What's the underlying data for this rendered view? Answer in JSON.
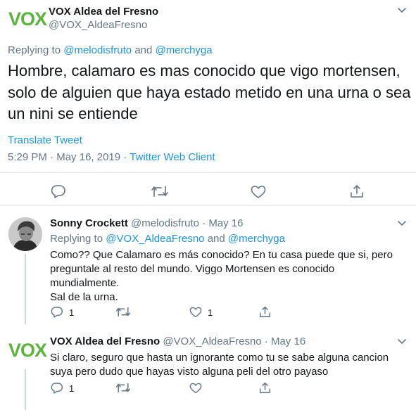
{
  "main_tweet": {
    "logo_text": "VOX",
    "display_name": "VOX Aldea del Fresno",
    "handle": "@VOX_AldeaFresno",
    "replying_prefix": "Replying to",
    "reply_mention_1": "@melodisfruto",
    "reply_and": "and",
    "reply_mention_2": "@merchyga",
    "text": "Hombre, calamaro es mas conocido que vigo mortensen, solo de alguien que haya estado metido en una urna o sea un nini se entiende",
    "translate": "Translate Tweet",
    "time": "5:29 PM",
    "date": "May 16, 2019",
    "dot": "·",
    "client": "Twitter Web Client"
  },
  "reply_1": {
    "display_name": "Sonny Crockett",
    "handle": "@melodisfruto",
    "dot": "·",
    "date": "May 16",
    "replying_prefix": "Replying to",
    "reply_mention_1": "@VOX_AldeaFresno",
    "reply_and": "and",
    "reply_mention_2": "@merchyga",
    "lines": [
      "Como?? Que Calamaro es más conocido? En tu casa puede que si, pero",
      "preguntale al resto del mundo. Viggo Mortensen es conocido",
      "mundialmente.",
      "Sal de la urna."
    ],
    "reply_count": "1",
    "like_count": "1"
  },
  "reply_2": {
    "logo_text": "VOX",
    "display_name": "VOX Aldea del Fresno",
    "handle": "@VOX_AldeaFresno",
    "dot": "·",
    "date": "May 16",
    "lines": [
      "Si claro, seguro que hasta un ignorante como tu se sabe alguna cancion",
      "suya pero dudo que hayas visto alguna peli del otro payaso"
    ],
    "reply_count": "1"
  },
  "colors": {
    "link": "#1b95e0",
    "muted": "#657786",
    "vox_green": "#5bb43c",
    "divider": "#e6ecf0",
    "icon": "#657786"
  },
  "icons": [
    "chevron-down-icon",
    "reply-icon",
    "retweet-icon",
    "like-icon",
    "share-icon"
  ]
}
